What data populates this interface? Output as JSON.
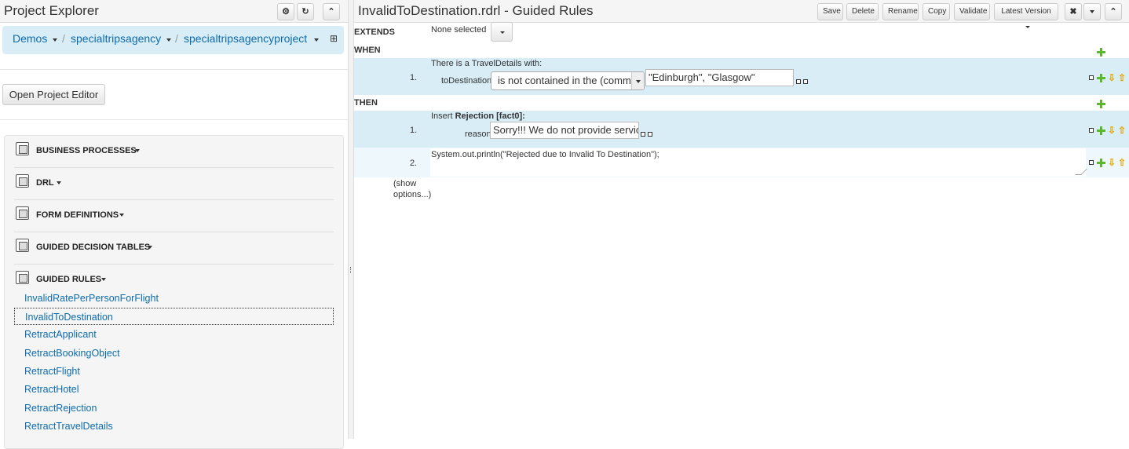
{
  "explorer": {
    "title": "Project Explorer",
    "breadcrumb": [
      "Demos",
      "specialtripsagency",
      "specialtripsagencyproject"
    ],
    "open_editor_label": "Open Project Editor",
    "groups": [
      {
        "label": "BUSINESS PROCESSES",
        "icon": "business-process-icon"
      },
      {
        "label": "DRL",
        "icon": "drl-file-icon"
      },
      {
        "label": "FORM DEFINITIONS",
        "icon": "form-definition-icon"
      },
      {
        "label": "GUIDED DECISION TABLES",
        "icon": "decision-table-icon"
      },
      {
        "label": "GUIDED RULES",
        "icon": "guided-rule-icon"
      }
    ],
    "rules": [
      "InvalidRatePerPersonForFlight",
      "InvalidToDestination",
      "RetractApplicant",
      "RetractBookingObject",
      "RetractFlight",
      "RetractHotel",
      "RetractRejection",
      "RetractTravelDetails"
    ],
    "selected_rule": "InvalidToDestination"
  },
  "editor": {
    "title": "InvalidToDestination.rdrl - Guided Rules",
    "toolbar": {
      "save": "Save",
      "delete": "Delete",
      "rename": "Rename",
      "copy": "Copy",
      "validate": "Validate",
      "version": "Latest Version"
    },
    "extends_label": "EXTENDS",
    "extends_value": "None selected",
    "when_label": "WHEN",
    "when": {
      "num": "1.",
      "pattern": "There is a TravelDetails with:",
      "field": "toDestination",
      "operator": "is not contained in the (comm",
      "value": "\"Edinburgh\", \"Glasgow\""
    },
    "then_label": "THEN",
    "then": [
      {
        "num": "1.",
        "insert_prefix": "Insert ",
        "insert_fact": "Rejection [fact0]",
        "insert_suffix": ":",
        "field": "reason",
        "value": "Sorry!!! We do not provide service"
      },
      {
        "num": "2.",
        "code": "System.out.println(\"Rejected due to Invalid To Destination\");"
      }
    ],
    "show_options": "(show options...)"
  },
  "colors": {
    "link": "#0d6bad",
    "row_highlight": "#d9edf7",
    "add_green": "#5cb82b",
    "arrow_yellow": "#e0a800"
  }
}
